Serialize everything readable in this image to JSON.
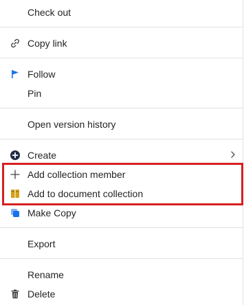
{
  "menu": {
    "check_out": "Check out",
    "copy_link": "Copy link",
    "follow": "Follow",
    "pin": "Pin",
    "open_version_history": "Open version history",
    "create": "Create",
    "add_collection_member": "Add collection member",
    "add_to_document_collection": "Add to document collection",
    "make_copy": "Make Copy",
    "export": "Export",
    "rename": "Rename",
    "delete": "Delete"
  },
  "icons": {
    "copy_link": "link-icon",
    "follow": "flag-icon",
    "create": "plus-circle-icon",
    "create_submenu": "chevron-right-icon",
    "add_collection_member": "plus-icon",
    "add_to_document_collection": "document-collection-icon",
    "make_copy": "copy-icon",
    "delete": "trash-icon"
  },
  "colors": {
    "highlight": "#d61f1f",
    "follow_accent": "#1a73e8",
    "collection_accent": "#d4a017",
    "copy_accent": "#1a73e8"
  }
}
